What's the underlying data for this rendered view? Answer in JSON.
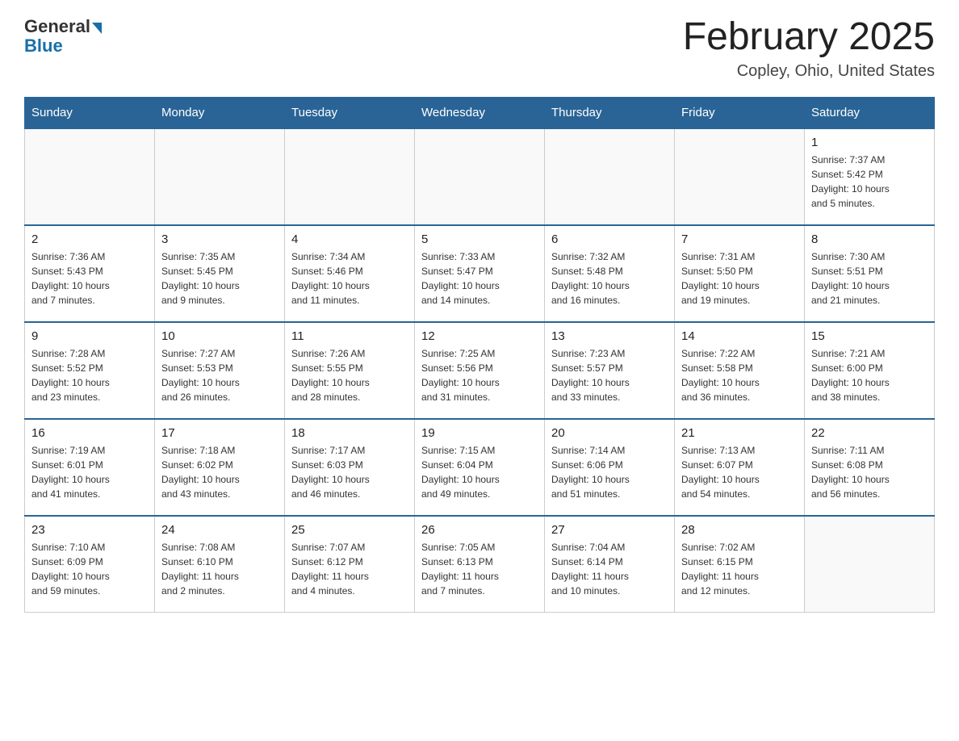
{
  "header": {
    "logo_general": "General",
    "logo_blue": "Blue",
    "main_title": "February 2025",
    "subtitle": "Copley, Ohio, United States"
  },
  "calendar": {
    "days_of_week": [
      "Sunday",
      "Monday",
      "Tuesday",
      "Wednesday",
      "Thursday",
      "Friday",
      "Saturday"
    ],
    "weeks": [
      [
        {
          "day": "",
          "info": ""
        },
        {
          "day": "",
          "info": ""
        },
        {
          "day": "",
          "info": ""
        },
        {
          "day": "",
          "info": ""
        },
        {
          "day": "",
          "info": ""
        },
        {
          "day": "",
          "info": ""
        },
        {
          "day": "1",
          "info": "Sunrise: 7:37 AM\nSunset: 5:42 PM\nDaylight: 10 hours\nand 5 minutes."
        }
      ],
      [
        {
          "day": "2",
          "info": "Sunrise: 7:36 AM\nSunset: 5:43 PM\nDaylight: 10 hours\nand 7 minutes."
        },
        {
          "day": "3",
          "info": "Sunrise: 7:35 AM\nSunset: 5:45 PM\nDaylight: 10 hours\nand 9 minutes."
        },
        {
          "day": "4",
          "info": "Sunrise: 7:34 AM\nSunset: 5:46 PM\nDaylight: 10 hours\nand 11 minutes."
        },
        {
          "day": "5",
          "info": "Sunrise: 7:33 AM\nSunset: 5:47 PM\nDaylight: 10 hours\nand 14 minutes."
        },
        {
          "day": "6",
          "info": "Sunrise: 7:32 AM\nSunset: 5:48 PM\nDaylight: 10 hours\nand 16 minutes."
        },
        {
          "day": "7",
          "info": "Sunrise: 7:31 AM\nSunset: 5:50 PM\nDaylight: 10 hours\nand 19 minutes."
        },
        {
          "day": "8",
          "info": "Sunrise: 7:30 AM\nSunset: 5:51 PM\nDaylight: 10 hours\nand 21 minutes."
        }
      ],
      [
        {
          "day": "9",
          "info": "Sunrise: 7:28 AM\nSunset: 5:52 PM\nDaylight: 10 hours\nand 23 minutes."
        },
        {
          "day": "10",
          "info": "Sunrise: 7:27 AM\nSunset: 5:53 PM\nDaylight: 10 hours\nand 26 minutes."
        },
        {
          "day": "11",
          "info": "Sunrise: 7:26 AM\nSunset: 5:55 PM\nDaylight: 10 hours\nand 28 minutes."
        },
        {
          "day": "12",
          "info": "Sunrise: 7:25 AM\nSunset: 5:56 PM\nDaylight: 10 hours\nand 31 minutes."
        },
        {
          "day": "13",
          "info": "Sunrise: 7:23 AM\nSunset: 5:57 PM\nDaylight: 10 hours\nand 33 minutes."
        },
        {
          "day": "14",
          "info": "Sunrise: 7:22 AM\nSunset: 5:58 PM\nDaylight: 10 hours\nand 36 minutes."
        },
        {
          "day": "15",
          "info": "Sunrise: 7:21 AM\nSunset: 6:00 PM\nDaylight: 10 hours\nand 38 minutes."
        }
      ],
      [
        {
          "day": "16",
          "info": "Sunrise: 7:19 AM\nSunset: 6:01 PM\nDaylight: 10 hours\nand 41 minutes."
        },
        {
          "day": "17",
          "info": "Sunrise: 7:18 AM\nSunset: 6:02 PM\nDaylight: 10 hours\nand 43 minutes."
        },
        {
          "day": "18",
          "info": "Sunrise: 7:17 AM\nSunset: 6:03 PM\nDaylight: 10 hours\nand 46 minutes."
        },
        {
          "day": "19",
          "info": "Sunrise: 7:15 AM\nSunset: 6:04 PM\nDaylight: 10 hours\nand 49 minutes."
        },
        {
          "day": "20",
          "info": "Sunrise: 7:14 AM\nSunset: 6:06 PM\nDaylight: 10 hours\nand 51 minutes."
        },
        {
          "day": "21",
          "info": "Sunrise: 7:13 AM\nSunset: 6:07 PM\nDaylight: 10 hours\nand 54 minutes."
        },
        {
          "day": "22",
          "info": "Sunrise: 7:11 AM\nSunset: 6:08 PM\nDaylight: 10 hours\nand 56 minutes."
        }
      ],
      [
        {
          "day": "23",
          "info": "Sunrise: 7:10 AM\nSunset: 6:09 PM\nDaylight: 10 hours\nand 59 minutes."
        },
        {
          "day": "24",
          "info": "Sunrise: 7:08 AM\nSunset: 6:10 PM\nDaylight: 11 hours\nand 2 minutes."
        },
        {
          "day": "25",
          "info": "Sunrise: 7:07 AM\nSunset: 6:12 PM\nDaylight: 11 hours\nand 4 minutes."
        },
        {
          "day": "26",
          "info": "Sunrise: 7:05 AM\nSunset: 6:13 PM\nDaylight: 11 hours\nand 7 minutes."
        },
        {
          "day": "27",
          "info": "Sunrise: 7:04 AM\nSunset: 6:14 PM\nDaylight: 11 hours\nand 10 minutes."
        },
        {
          "day": "28",
          "info": "Sunrise: 7:02 AM\nSunset: 6:15 PM\nDaylight: 11 hours\nand 12 minutes."
        },
        {
          "day": "",
          "info": ""
        }
      ]
    ]
  }
}
